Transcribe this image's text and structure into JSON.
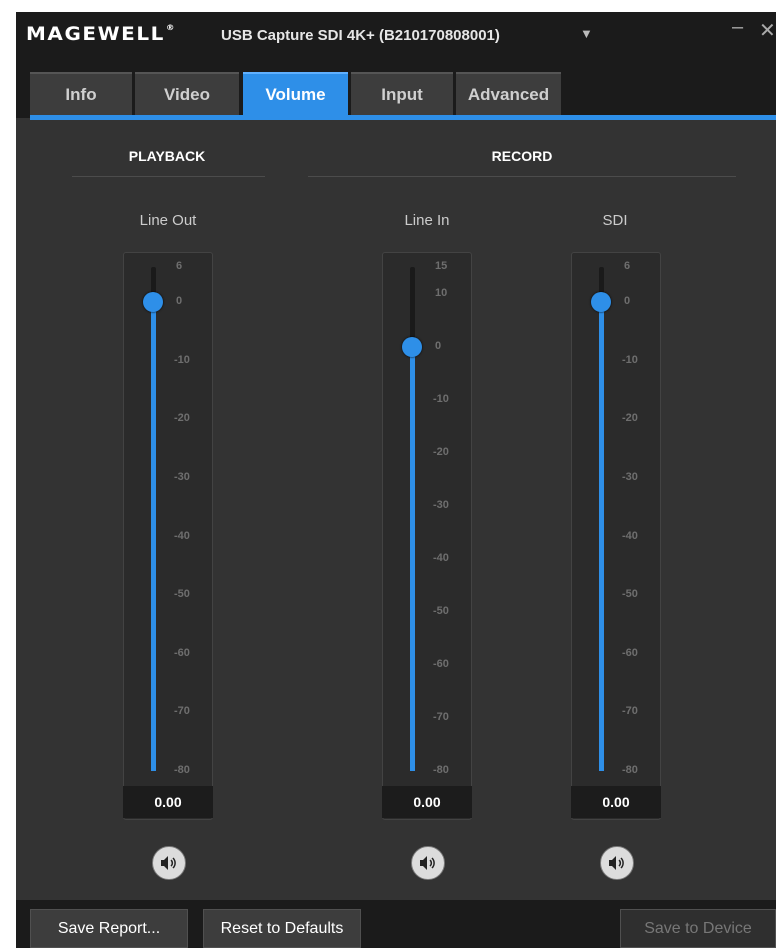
{
  "titlebar": {
    "logo": "MAGEWELL",
    "logo_mark": "®",
    "device_title": "USB Capture SDI 4K+ (B210170808001)",
    "device_dropdown_icon": "chevron-down-icon",
    "minimize_icon": "minimize-icon",
    "close_icon": "close-icon"
  },
  "tabs": [
    {
      "label": "Info"
    },
    {
      "label": "Video"
    },
    {
      "label": "Volume",
      "active": true
    },
    {
      "label": "Input"
    },
    {
      "label": "Advanced"
    }
  ],
  "sections": {
    "playback": "PLAYBACK",
    "record": "RECORD"
  },
  "channels": [
    {
      "label": "Line Out",
      "value": "0.00",
      "ticks": [
        "6",
        "0",
        "-10",
        "-20",
        "-30",
        "-40",
        "-50",
        "-60",
        "-70",
        "-80"
      ],
      "scale_max": 6,
      "scale_min": -80,
      "level": 0
    },
    {
      "label": "Line In",
      "value": "0.00",
      "ticks": [
        "15",
        "10",
        "0",
        "-10",
        "-20",
        "-30",
        "-40",
        "-50",
        "-60",
        "-70",
        "-80"
      ],
      "scale_max": 15,
      "scale_min": -80,
      "level": 0
    },
    {
      "label": "SDI",
      "value": "0.00",
      "ticks": [
        "6",
        "0",
        "-10",
        "-20",
        "-30",
        "-40",
        "-50",
        "-60",
        "-70",
        "-80"
      ],
      "scale_max": 6,
      "scale_min": -80,
      "level": 0
    }
  ],
  "mute_icon": "speaker-icon",
  "footer": {
    "save_report": "Save Report...",
    "reset_defaults": "Reset to Defaults",
    "save_device": "Save to Device"
  },
  "colors": {
    "accent": "#2e8fe8",
    "background": "#333333",
    "titlebar": "#1b1b1b"
  }
}
